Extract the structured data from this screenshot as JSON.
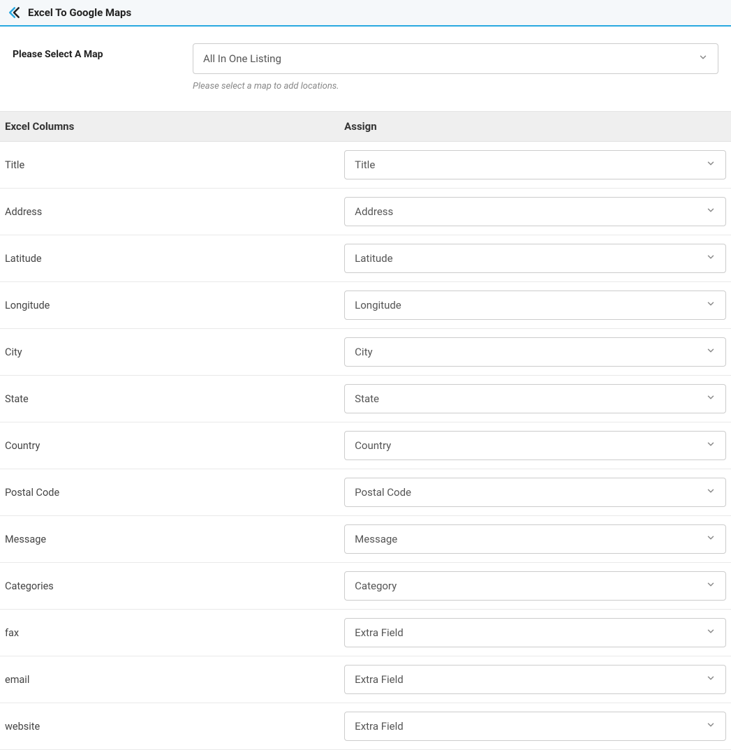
{
  "header": {
    "title": "Excel To Google Maps"
  },
  "map_select": {
    "label": "Please Select A Map",
    "value": "All In One Listing",
    "help_text": "Please select a map to add locations."
  },
  "table": {
    "header_col1": "Excel Columns",
    "header_col2": "Assign",
    "rows": [
      {
        "excel_column": "Title",
        "assign_value": "Title"
      },
      {
        "excel_column": "Address",
        "assign_value": "Address"
      },
      {
        "excel_column": "Latitude",
        "assign_value": "Latitude"
      },
      {
        "excel_column": "Longitude",
        "assign_value": "Longitude"
      },
      {
        "excel_column": "City",
        "assign_value": "City"
      },
      {
        "excel_column": "State",
        "assign_value": "State"
      },
      {
        "excel_column": "Country",
        "assign_value": "Country"
      },
      {
        "excel_column": "Postal Code",
        "assign_value": "Postal Code"
      },
      {
        "excel_column": "Message",
        "assign_value": "Message"
      },
      {
        "excel_column": "Categories",
        "assign_value": "Category"
      },
      {
        "excel_column": "fax",
        "assign_value": "Extra Field"
      },
      {
        "excel_column": "email",
        "assign_value": "Extra Field"
      },
      {
        "excel_column": "website",
        "assign_value": "Extra Field"
      }
    ]
  }
}
